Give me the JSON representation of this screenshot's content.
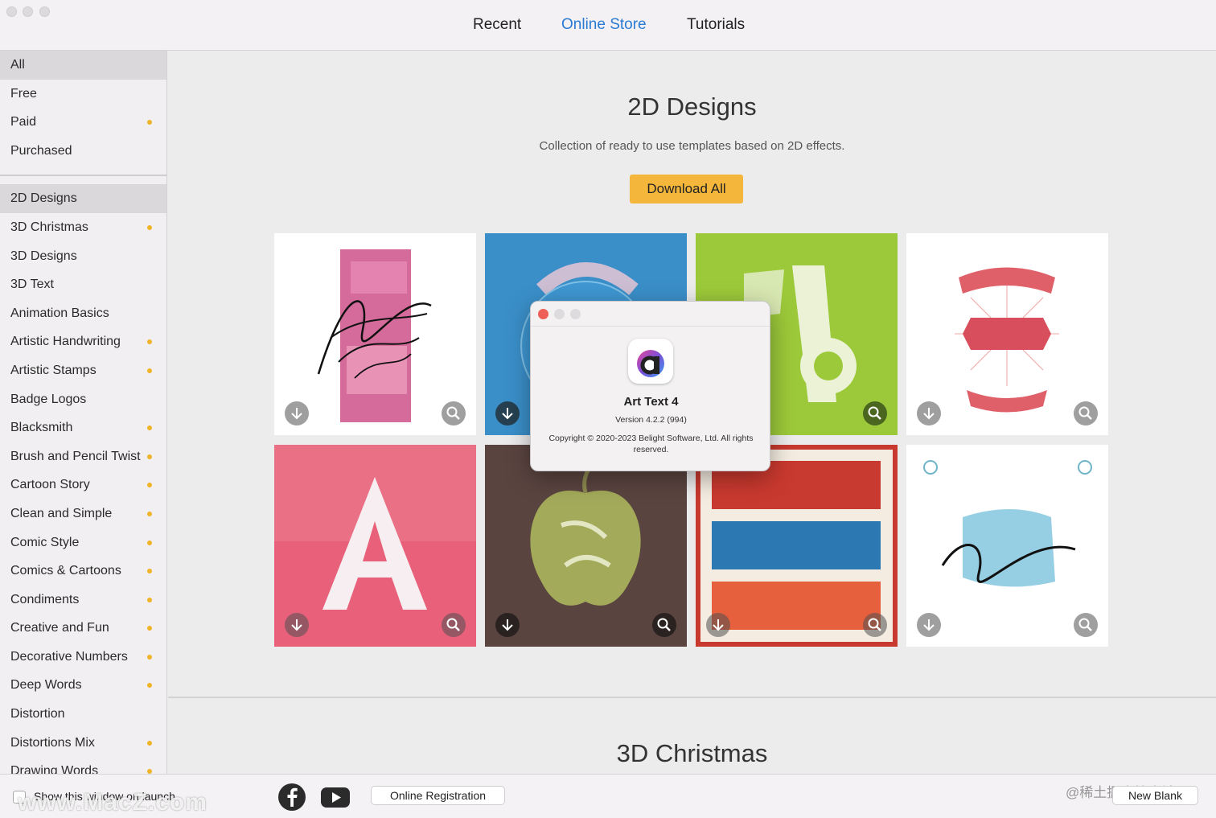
{
  "window": {
    "tabs": [
      {
        "label": "Recent",
        "active": false
      },
      {
        "label": "Online Store",
        "active": true
      },
      {
        "label": "Tutorials",
        "active": false
      }
    ]
  },
  "sidebar": {
    "filters": [
      {
        "label": "All",
        "selected": true,
        "paid": false
      },
      {
        "label": "Free",
        "selected": false,
        "paid": false
      },
      {
        "label": "Paid",
        "selected": false,
        "paid": true
      },
      {
        "label": "Purchased",
        "selected": false,
        "paid": false
      }
    ],
    "categories": [
      {
        "label": "2D Designs",
        "selected": true,
        "paid": false
      },
      {
        "label": "3D Christmas",
        "selected": false,
        "paid": true
      },
      {
        "label": "3D Designs",
        "selected": false,
        "paid": false
      },
      {
        "label": "3D Text",
        "selected": false,
        "paid": false
      },
      {
        "label": "Animation Basics",
        "selected": false,
        "paid": false
      },
      {
        "label": "Artistic Handwriting",
        "selected": false,
        "paid": true
      },
      {
        "label": "Artistic Stamps",
        "selected": false,
        "paid": true
      },
      {
        "label": "Badge Logos",
        "selected": false,
        "paid": false
      },
      {
        "label": "Blacksmith",
        "selected": false,
        "paid": true
      },
      {
        "label": "Brush and Pencil Twist",
        "selected": false,
        "paid": true
      },
      {
        "label": "Cartoon Story",
        "selected": false,
        "paid": true
      },
      {
        "label": "Clean and Simple",
        "selected": false,
        "paid": true
      },
      {
        "label": "Comic Style",
        "selected": false,
        "paid": true
      },
      {
        "label": "Comics & Cartoons",
        "selected": false,
        "paid": true
      },
      {
        "label": "Condiments",
        "selected": false,
        "paid": true
      },
      {
        "label": "Creative and Fun",
        "selected": false,
        "paid": true
      },
      {
        "label": "Decorative Numbers",
        "selected": false,
        "paid": true
      },
      {
        "label": "Deep Words",
        "selected": false,
        "paid": true
      },
      {
        "label": "Distortion",
        "selected": false,
        "paid": false
      },
      {
        "label": "Distortions Mix",
        "selected": false,
        "paid": true
      },
      {
        "label": "Drawing Words",
        "selected": false,
        "paid": true
      }
    ]
  },
  "main": {
    "section1": {
      "title": "2D Designs",
      "description": "Collection of ready to use templates based on 2D effects.",
      "download_all": "Download All"
    },
    "section2": {
      "title": "3D Christmas"
    },
    "templates": [
      {
        "name": "handwriting",
        "background": "#ffffff"
      },
      {
        "name": "a-bird",
        "background": "#3a8fc9"
      },
      {
        "name": "big-a",
        "background": "#9cc93a"
      },
      {
        "name": "fortune-favours-the-brave",
        "background": "#ffffff"
      },
      {
        "name": "art-text-a",
        "background": "#e8607a"
      },
      {
        "name": "live-and-learn",
        "background": "#5a4440"
      },
      {
        "name": "haste-makes-waste",
        "background": "#f4ece0"
      },
      {
        "name": "keep-it-simple",
        "background": "#ffffff"
      }
    ]
  },
  "about_dialog": {
    "app_name": "Art Text 4",
    "version": "Version 4.2.2 (994)",
    "copyright": "Copyright © 2020-2023 Belight Software, Ltd. All rights reserved."
  },
  "bottom": {
    "show_on_launch": "Show this window on launch",
    "online_registration": "Online Registration",
    "new_blank": "New Blank",
    "watermark_left": "www.MacZ.com",
    "watermark_right": "@稀土掘金技术社区"
  },
  "colors": {
    "accent": "#2a7bd4",
    "download_all_button": "#f4b73b",
    "paid_dot": "#f0b429"
  }
}
